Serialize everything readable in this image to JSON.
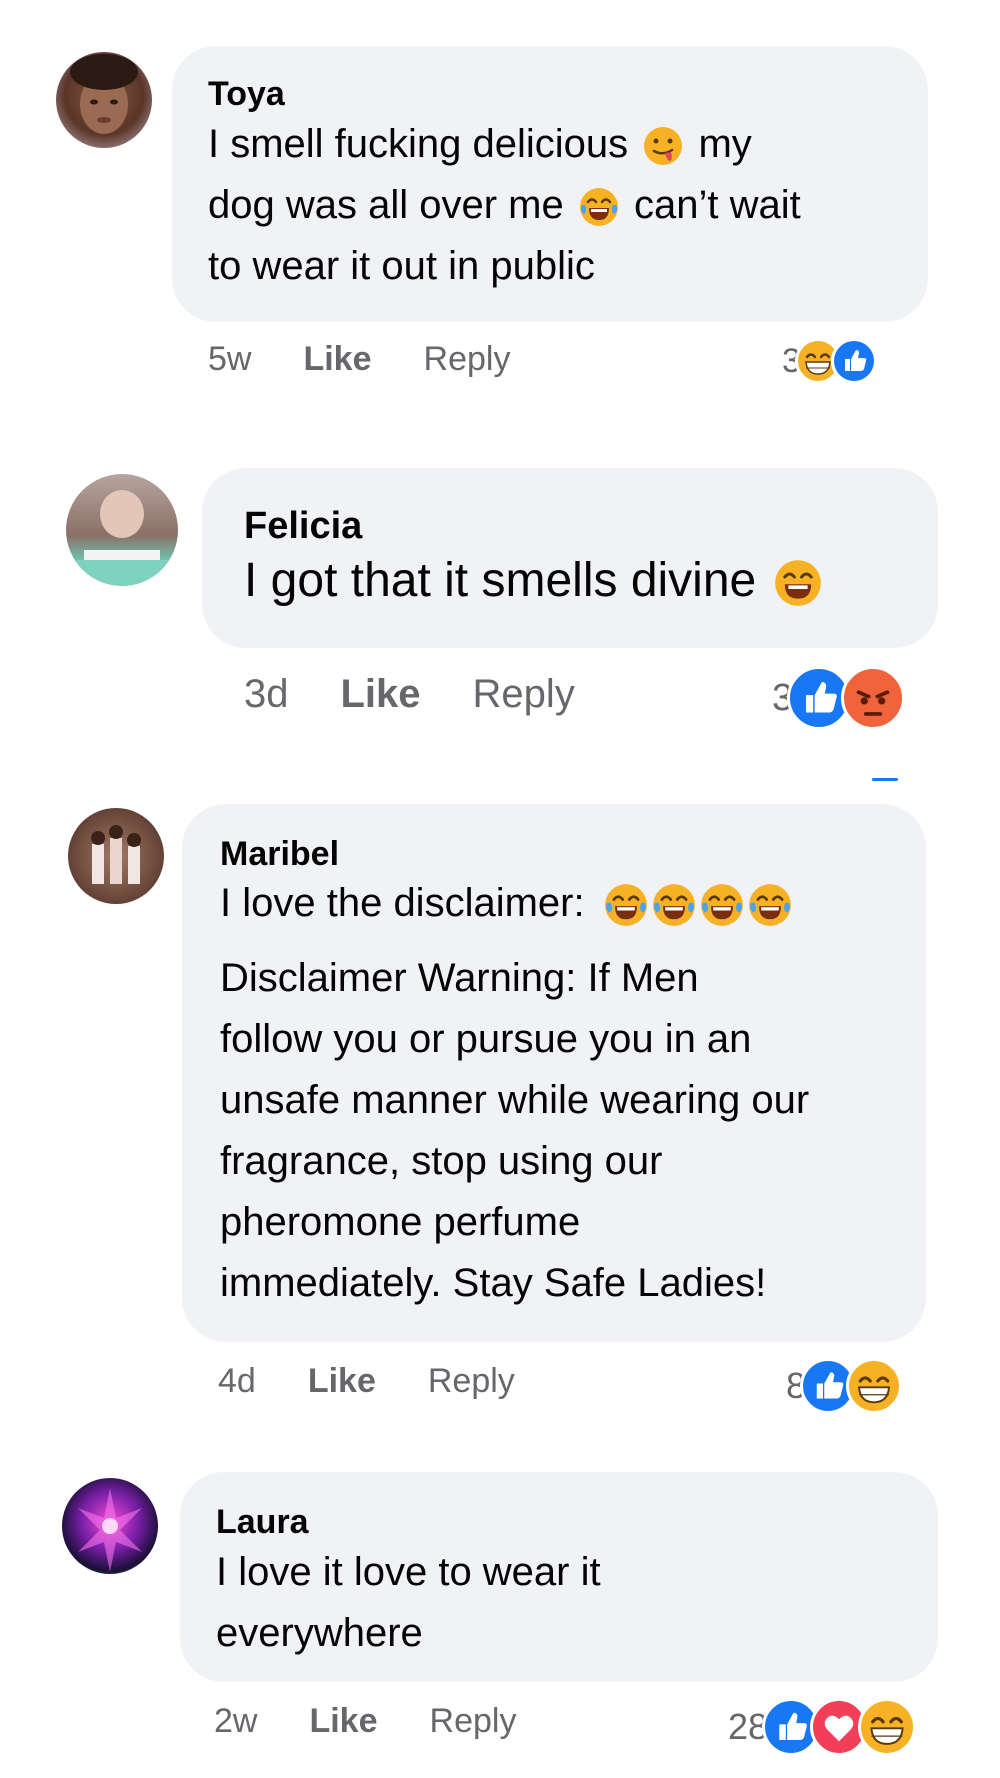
{
  "comments": [
    {
      "name": "Toya",
      "text_parts": [
        "I smell fucking delicious",
        "my",
        "dog was all over me",
        "can’t wait",
        "to wear it out in public"
      ],
      "time": "5w",
      "like_label": "Like",
      "reply_label": "Reply",
      "reaction_count": "3",
      "reactions": [
        "haha-icon",
        "like-icon"
      ]
    },
    {
      "name": "Felicia",
      "text": "I got that it smells divine",
      "time": "3d",
      "like_label": "Like",
      "reply_label": "Reply",
      "reaction_count": "3",
      "reactions": [
        "like-icon",
        "angry-icon"
      ]
    },
    {
      "name": "Maribel",
      "text_line1": "I love the disclaimer:",
      "text_lines": [
        "Disclaimer Warning: If Men",
        "follow you or pursue you in an",
        "unsafe manner while wearing our",
        "fragrance, stop using our",
        "pheromone perfume",
        "immediately. Stay Safe Ladies!"
      ],
      "time": "4d",
      "like_label": "Like",
      "reply_label": "Reply",
      "reaction_count": "8",
      "reactions": [
        "like-icon",
        "haha-icon"
      ]
    },
    {
      "name": "Laura",
      "text_lines": [
        "I love it love to wear it",
        "everywhere"
      ],
      "time": "2w",
      "like_label": "Like",
      "reply_label": "Reply",
      "reaction_count": "28",
      "reactions": [
        "like-icon",
        "love-icon",
        "haha-icon"
      ]
    }
  ],
  "colors": {
    "bubble": "#f0f2f5",
    "meta_text": "#65676b",
    "like_blue": "#1877f2",
    "love_red": "#f33e58",
    "haha_yellow": "#f7b125",
    "angry_orange": "#f0643c"
  }
}
